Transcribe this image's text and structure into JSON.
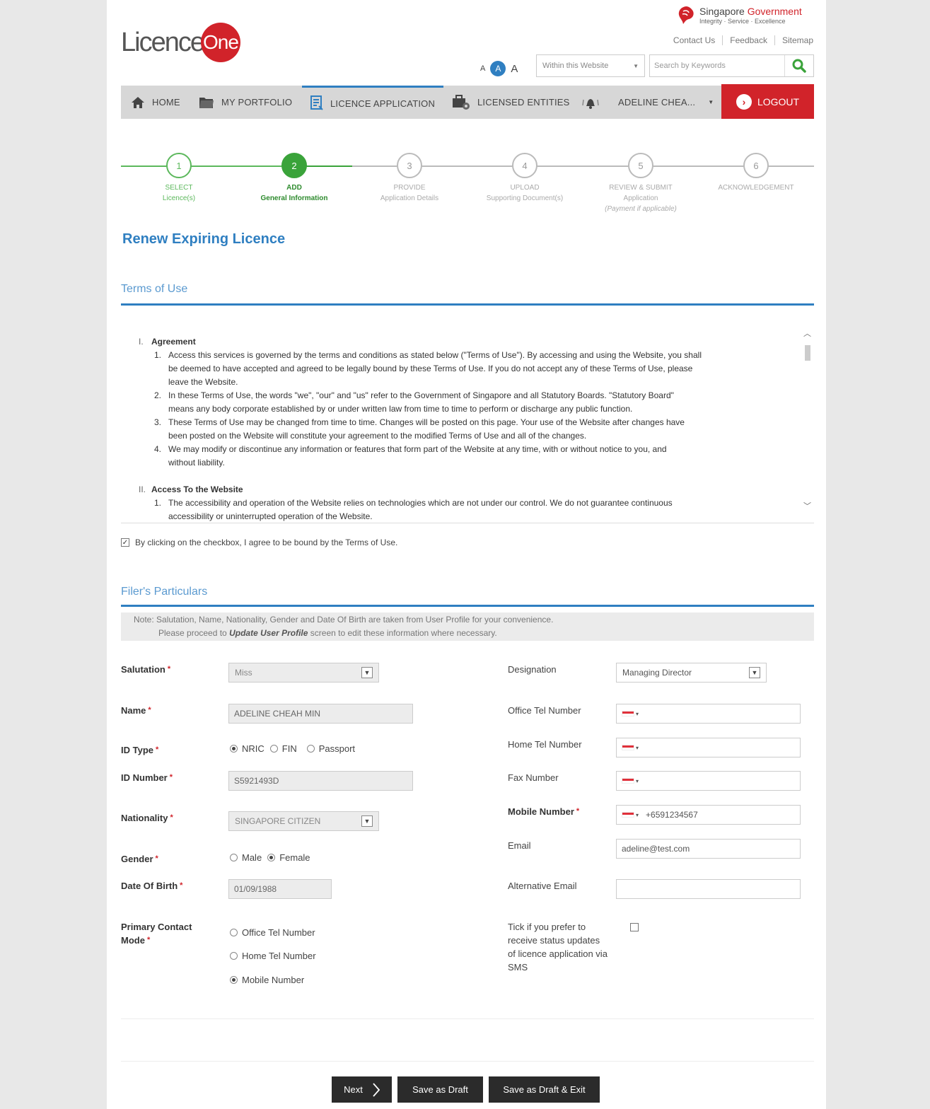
{
  "header": {
    "gov_name_1": "Singapore",
    "gov_name_2": "Government",
    "gov_motto": "Integrity · Service · Excellence",
    "util_links": [
      "Contact Us",
      "Feedback",
      "Sitemap"
    ],
    "brand_text": "Licence",
    "brand_badge": "One",
    "font_small": "A",
    "font_medium": "A",
    "font_large": "A",
    "scope_select": "Within this Website",
    "search_placeholder": "Search by Keywords"
  },
  "nav": {
    "home": "HOME",
    "portfolio": "MY PORTFOLIO",
    "application": "LICENCE APPLICATION",
    "entities": "LICENSED ENTITIES",
    "user": "ADELINE CHEA...",
    "logout": "LOGOUT"
  },
  "steps": [
    {
      "num": "1",
      "line1": "SELECT",
      "line2": "Licence(s)",
      "line3": ""
    },
    {
      "num": "2",
      "line1": "ADD",
      "line2": "General Information",
      "line3": ""
    },
    {
      "num": "3",
      "line1": "PROVIDE",
      "line2": "Application Details",
      "line3": ""
    },
    {
      "num": "4",
      "line1": "UPLOAD",
      "line2": "Supporting Document(s)",
      "line3": ""
    },
    {
      "num": "5",
      "line1": "REVIEW & SUBMIT",
      "line2": "Application",
      "line3": "(Payment if applicable)"
    },
    {
      "num": "6",
      "line1": "ACKNOWLEDGEMENT",
      "line2": "",
      "line3": ""
    }
  ],
  "page_title": "Renew Expiring Licence",
  "terms": {
    "section_title": "Terms of Use",
    "s1_num": "I.",
    "s1_title": "Agreement",
    "s1_items": [
      {
        "n": "1.",
        "lines": [
          "Access this services is governed by the terms and conditions as stated below (\"Terms of Use\"). By accessing and using the Website, you shall",
          "be deemed to have accepted and agreed to be legally bound by these Terms of Use. If you do not accept any of these Terms of Use, please",
          "leave the Website."
        ]
      },
      {
        "n": "2.",
        "lines": [
          "In these Terms of Use, the words \"we\", \"our\" and \"us\" refer to the Government of Singapore and all Statutory Boards. \"Statutory Board\"",
          "means any body corporate established by or under written law from time to time to perform or discharge any public function."
        ]
      },
      {
        "n": "3.",
        "lines": [
          "These Terms of Use may be changed from time to time. Changes will be posted on this page. Your use of the Website after changes have",
          "been posted on the Website will constitute your agreement to the modified Terms of Use and all of the changes."
        ]
      },
      {
        "n": "4.",
        "lines": [
          "We may modify or discontinue any information or features that form part of the Website at any time, with or without notice to you, and",
          "without liability."
        ]
      }
    ],
    "s2_num": "II.",
    "s2_title": "Access To the Website",
    "s2_items": [
      {
        "n": "1.",
        "lines": [
          "The accessibility and operation of the Website relies on technologies which are not under our control. We do not guarantee continuous",
          "accessibility or uninterrupted operation of the Website."
        ]
      }
    ],
    "agree_text": "By clicking on the checkbox, I agree to be bound by the Terms of Use."
  },
  "filer": {
    "section_title": "Filer's Particulars",
    "note_line1": "Note: Salutation, Name, Nationality, Gender and Date Of Birth are taken from User Profile for your convenience.",
    "note_pre": "Please proceed to ",
    "note_link": "Update User Profile",
    "note_post": " screen to edit these information where necessary.",
    "salutation_label": "Salutation",
    "salutation_value": "Miss",
    "name_label": "Name",
    "name_value": "ADELINE CHEAH MIN",
    "id_type_label": "ID Type",
    "id_type_options": [
      "NRIC",
      "FIN",
      "Passport"
    ],
    "id_number_label": "ID Number",
    "id_number_value": "S5921493D",
    "nationality_label": "Nationality",
    "nationality_value": "SINGAPORE CITIZEN",
    "gender_label": "Gender",
    "gender_options": [
      "Male",
      "Female"
    ],
    "dob_label": "Date Of Birth",
    "dob_value": "01/09/1988",
    "contact_mode_label_1": "Primary Contact",
    "contact_mode_label_2": "Mode",
    "contact_mode_options": [
      "Office Tel Number",
      "Home Tel Number",
      "Mobile Number"
    ],
    "designation_label": "Designation",
    "designation_value": "Managing Director",
    "office_tel_label": "Office Tel Number",
    "office_tel_value": "",
    "home_tel_label": "Home Tel Number",
    "home_tel_value": "",
    "fax_label": "Fax Number",
    "fax_value": "",
    "mobile_label": "Mobile Number",
    "mobile_value": "+6591234567",
    "email_label": "Email",
    "email_value": "adeline@test.com",
    "alt_email_label": "Alternative Email",
    "alt_email_value": "",
    "sms_label_lines": [
      "Tick if you prefer to",
      "receive status updates",
      "of licence application via",
      "SMS"
    ]
  },
  "buttons": {
    "next": "Next",
    "save_draft": "Save as Draft",
    "save_exit": "Save as Draft & Exit"
  },
  "colors": {
    "brand_red": "#d1232a",
    "accent_blue": "#2f7fc1",
    "step_green": "#3aa33a"
  }
}
